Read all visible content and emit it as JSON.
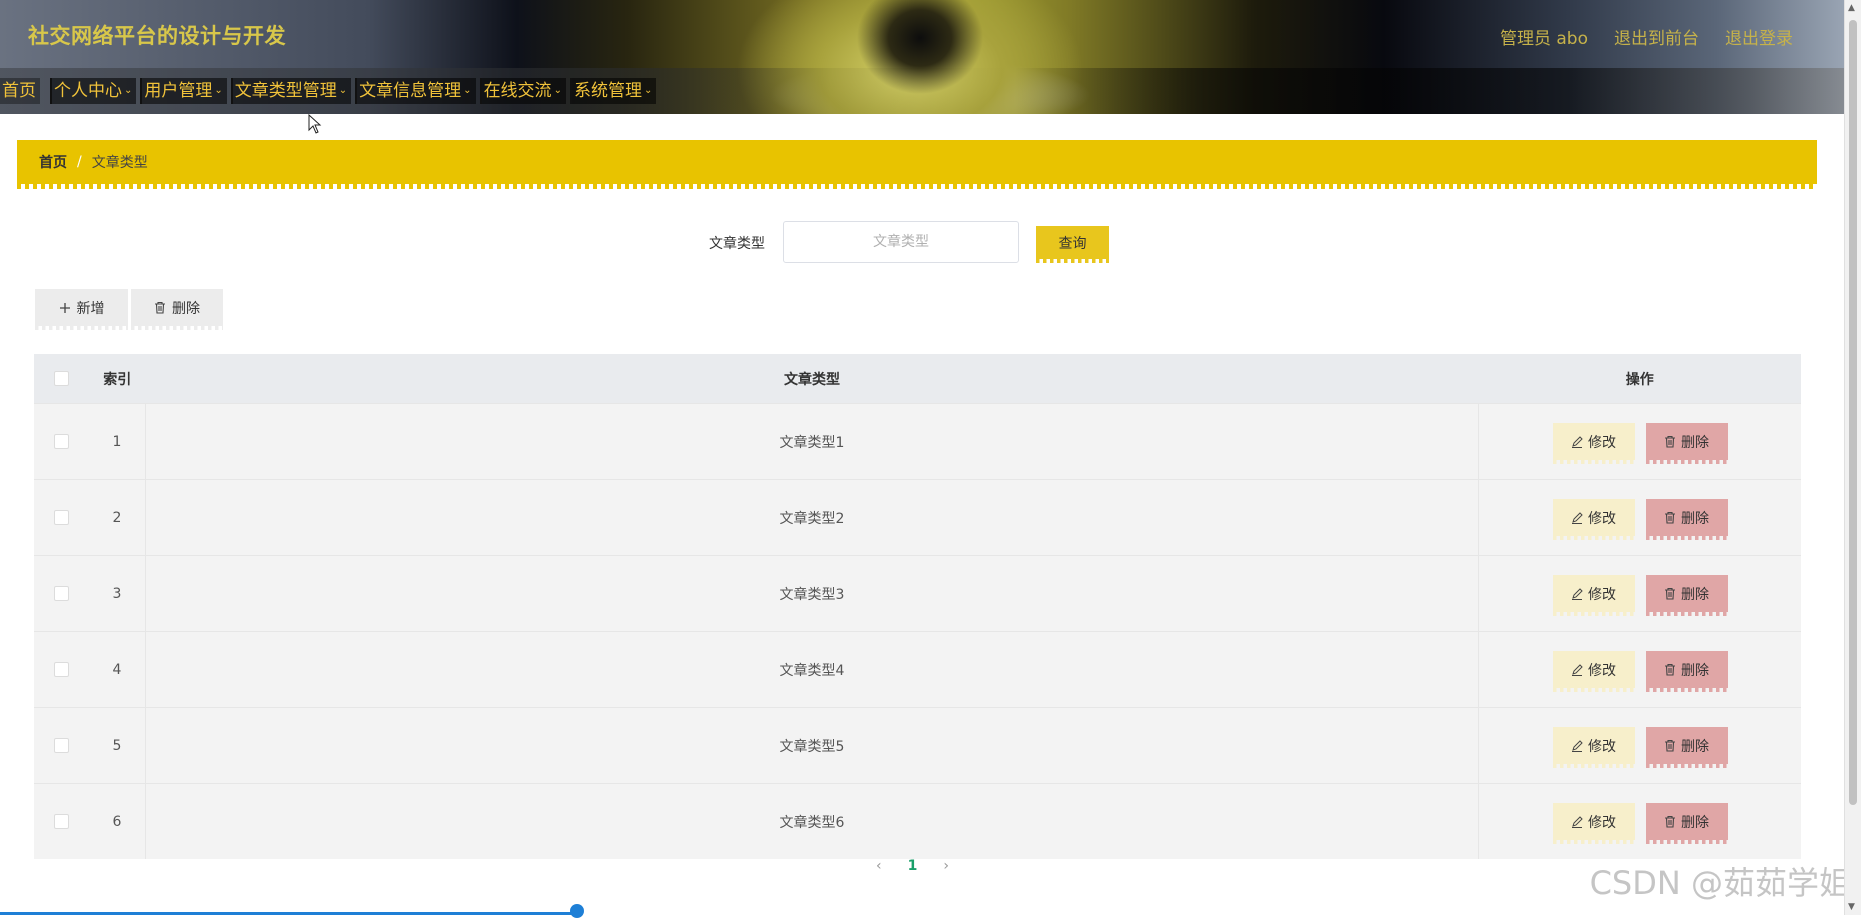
{
  "header": {
    "title": "社交网络平台的设计与开发",
    "links": [
      "管理员 abo",
      "退出到前台",
      "退出登录"
    ]
  },
  "nav": {
    "items": [
      {
        "label": "首页",
        "has_dropdown": false
      },
      {
        "label": "个人中心",
        "has_dropdown": true
      },
      {
        "label": "用户管理",
        "has_dropdown": true
      },
      {
        "label": "文章类型管理",
        "has_dropdown": true
      },
      {
        "label": "文章信息管理",
        "has_dropdown": true
      },
      {
        "label": "在线交流",
        "has_dropdown": true
      },
      {
        "label": "系统管理",
        "has_dropdown": true
      }
    ]
  },
  "breadcrumb": {
    "home": "首页",
    "separator": "/",
    "current": "文章类型"
  },
  "search": {
    "label": "文章类型",
    "placeholder": "文章类型",
    "value": "",
    "button": "查询"
  },
  "actions": {
    "add": "新增",
    "delete": "删除"
  },
  "table": {
    "headers": {
      "index": "索引",
      "type": "文章类型",
      "ops": "操作"
    },
    "rows": [
      {
        "index": "1",
        "type": "文章类型1"
      },
      {
        "index": "2",
        "type": "文章类型2"
      },
      {
        "index": "3",
        "type": "文章类型3"
      },
      {
        "index": "4",
        "type": "文章类型4"
      },
      {
        "index": "5",
        "type": "文章类型5"
      },
      {
        "index": "6",
        "type": "文章类型6"
      }
    ],
    "edit_label": "修改",
    "delete_label": "删除"
  },
  "pagination": {
    "current": "1",
    "prev": "‹",
    "next": "›"
  },
  "watermark": "CSDN @茹茹学姐",
  "colors": {
    "accent": "#e8c300",
    "edit": "#f7efcb",
    "delete": "#e0a6a6",
    "page_active": "#1a9f6a"
  }
}
